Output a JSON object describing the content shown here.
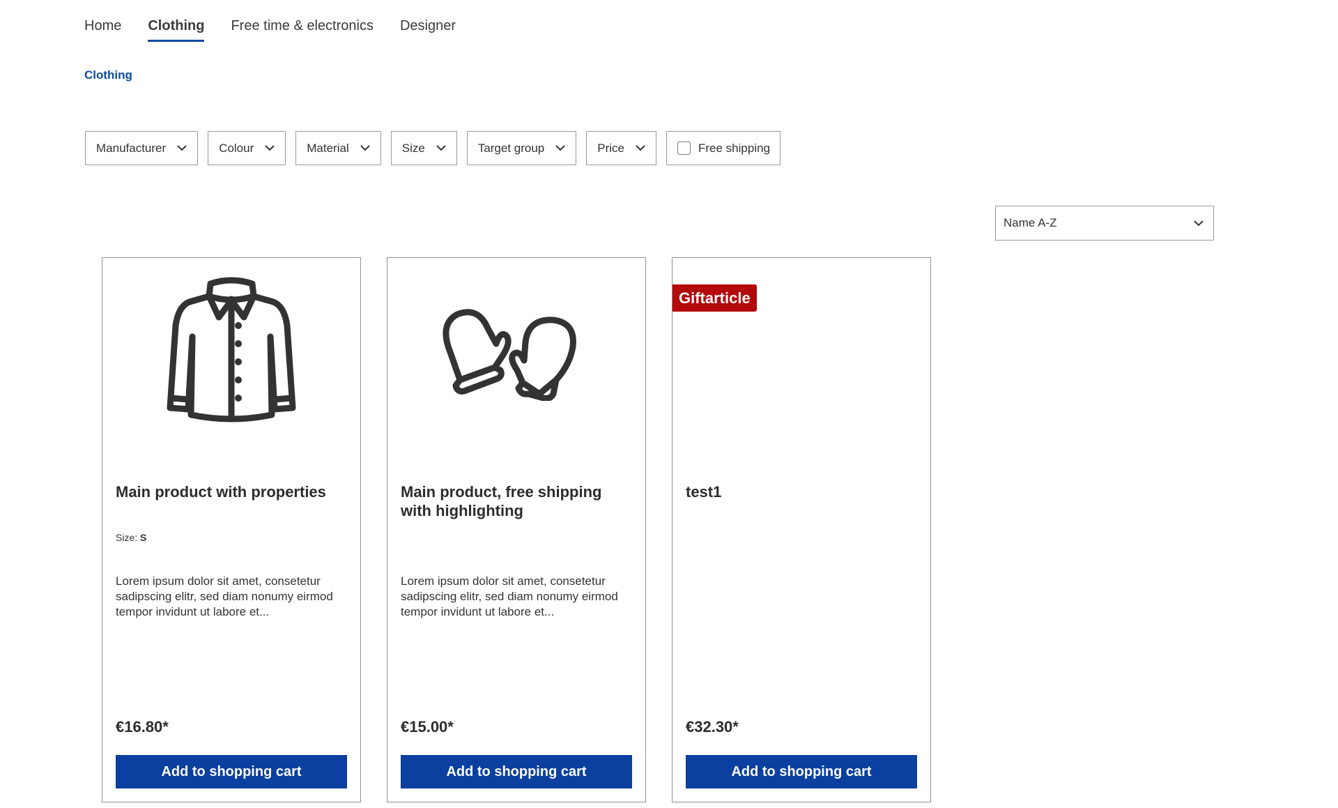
{
  "nav": {
    "items": [
      {
        "label": "Home",
        "active": false
      },
      {
        "label": "Clothing",
        "active": true
      },
      {
        "label": "Free time & electronics",
        "active": false
      },
      {
        "label": "Designer",
        "active": false
      }
    ]
  },
  "breadcrumb": {
    "label": "Clothing"
  },
  "filters": {
    "manufacturer": "Manufacturer",
    "colour": "Colour",
    "material": "Material",
    "size": "Size",
    "target_group": "Target group",
    "price": "Price",
    "free_shipping": "Free shipping",
    "free_shipping_checked": false
  },
  "sorting": {
    "selected": "Name A-Z"
  },
  "products": [
    {
      "name": "Main product with properties",
      "property_label": "Size:",
      "property_value": "S",
      "description": "Lorem ipsum dolor sit amet, consetetur sadipscing elitr, sed diam nonumy eirmod tempor invidunt ut labore et...",
      "price": "€16.80*",
      "button": "Add to shopping cart",
      "image_icon": "jacket-icon"
    },
    {
      "name": "Main product, free shipping with highlighting",
      "description": "Lorem ipsum dolor sit amet, consetetur sadipscing elitr, sed diam nonumy eirmod tempor invidunt ut labore et...",
      "price": "€15.00*",
      "button": "Add to shopping cart",
      "image_icon": "mittens-icon"
    },
    {
      "name": "test1",
      "badge": "Giftarticle",
      "price": "€32.30*",
      "button": "Add to shopping cart"
    }
  ],
  "colors": {
    "accent": "#0b3fa0",
    "badge": "#b4090d",
    "link": "#0b4aa2"
  }
}
